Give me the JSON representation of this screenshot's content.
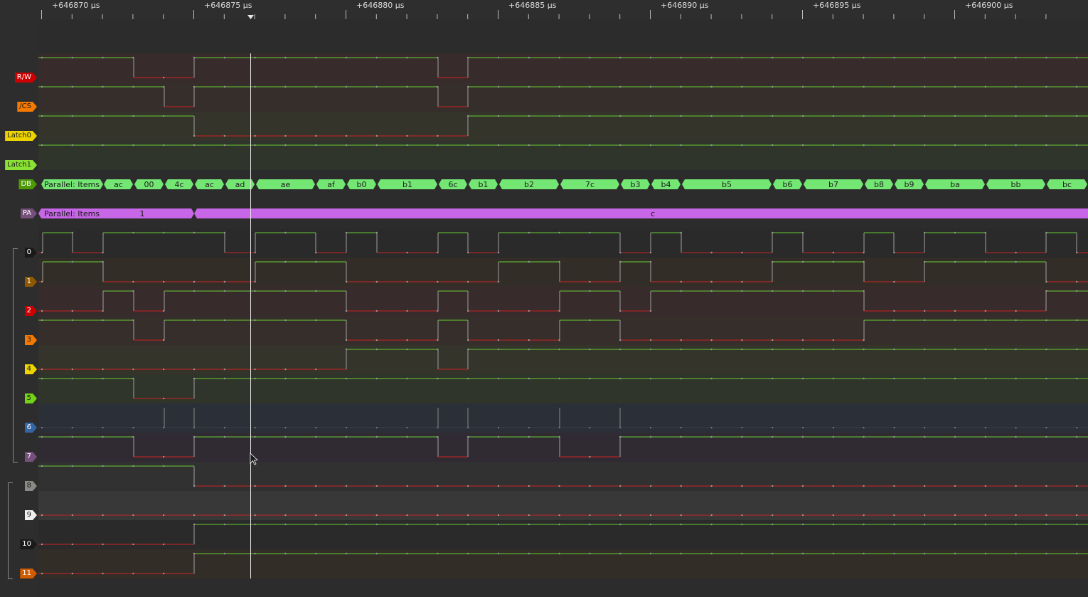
{
  "ruler": {
    "ticks": [
      {
        "label": "+646870 µs",
        "t": 646870
      },
      {
        "label": "+646875 µs",
        "t": 646875
      },
      {
        "label": "+646880 µs",
        "t": 646880
      },
      {
        "label": "+646885 µs",
        "t": 646885
      },
      {
        "label": "+646890 µs",
        "t": 646890
      },
      {
        "label": "+646895 µs",
        "t": 646895
      },
      {
        "label": "+646900 µs",
        "t": 646900
      }
    ]
  },
  "colors": {
    "high_line": "#66cc33",
    "low_line": "#cc2222",
    "db_decode": "#73e673",
    "pa_decode": "#c766e6",
    "cursor": "#e8e8e8"
  },
  "channels": [
    {
      "id": "rw",
      "label": "R/W",
      "color": "#cc0000",
      "text_color": "#ffffff"
    },
    {
      "id": "cs",
      "label": "/CS",
      "color": "#f57900",
      "text_color": "#1a1a1a"
    },
    {
      "id": "latch0",
      "label": "Latch0",
      "color": "#edd400",
      "text_color": "#1a1a1a"
    },
    {
      "id": "latch1",
      "label": "Latch1",
      "color": "#8ae234",
      "text_color": "#1a1a1a"
    },
    {
      "id": "db",
      "label": "DB",
      "color": "#4e9a06",
      "text_color": "#ffffff"
    },
    {
      "id": "pa",
      "label": "PA",
      "color": "#75507b",
      "text_color": "#ffffff"
    },
    {
      "id": "d0",
      "label": "0",
      "color": "#1a1a1a",
      "text_color": "#ffffff"
    },
    {
      "id": "d1",
      "label": "1",
      "color": "#8f5902",
      "text_color": "#ffffff"
    },
    {
      "id": "d2",
      "label": "2",
      "color": "#cc0000",
      "text_color": "#ffffff"
    },
    {
      "id": "d3",
      "label": "3",
      "color": "#f57900",
      "text_color": "#1a1a1a"
    },
    {
      "id": "d4",
      "label": "4",
      "color": "#edd400",
      "text_color": "#1a1a1a"
    },
    {
      "id": "d5",
      "label": "5",
      "color": "#73d216",
      "text_color": "#1a1a1a"
    },
    {
      "id": "d6",
      "label": "6",
      "color": "#3465a4",
      "text_color": "#ffffff"
    },
    {
      "id": "d7",
      "label": "7",
      "color": "#75507b",
      "text_color": "#ffffff"
    },
    {
      "id": "d8",
      "label": "8",
      "color": "#888a85",
      "text_color": "#1a1a1a"
    },
    {
      "id": "d9",
      "label": "9",
      "color": "#eeeeec",
      "text_color": "#1a1a1a"
    },
    {
      "id": "d10",
      "label": "10",
      "color": "#1a1a1a",
      "text_color": "#ffffff"
    },
    {
      "id": "d11",
      "label": "11",
      "color": "#ce5c00",
      "text_color": "#ffffff"
    }
  ],
  "decoders": {
    "db": {
      "start_label": "Parallel: Items",
      "values": [
        "ac",
        "00",
        "4c",
        "ac",
        "ad",
        "ae",
        "af",
        "b0",
        "b1",
        "6c",
        "b1",
        "b2",
        "7c",
        "b3",
        "b4",
        "b5",
        "b6",
        "b7",
        "b8",
        "b9",
        "ba",
        "bb",
        "bc"
      ]
    },
    "pa": {
      "start_label": "Parallel: Items",
      "values": [
        "1",
        "c"
      ]
    }
  }
}
